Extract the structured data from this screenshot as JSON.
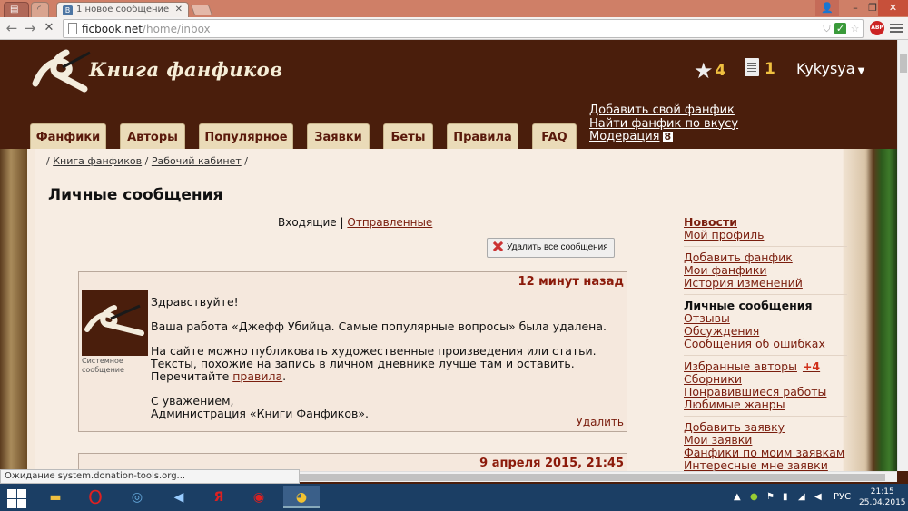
{
  "browser": {
    "tabs": [
      {
        "label": ""
      },
      {
        "label": ""
      },
      {
        "label": "1 новое сообщение",
        "favicon": "В"
      }
    ],
    "url_host": "ficbook.net",
    "url_path": "/home/inbox",
    "status_text": "Ожидание system.donation-tools.org...",
    "abp_label": "ABP"
  },
  "header": {
    "logo_text": "Книга фанфиков",
    "favorites_count": "4",
    "notes_count": "1",
    "username": "Kykysya",
    "quick_links": {
      "add": "Добавить свой фанфик",
      "find": "Найти фанфик по вкусу",
      "moderation": "Модерация",
      "moderation_count": "8"
    },
    "nav_tabs": [
      "Фанфики",
      "Авторы",
      "Популярное",
      "Заявки",
      "Беты",
      "Правила",
      "FAQ"
    ]
  },
  "breadcrumb": {
    "sep": "/",
    "items": [
      "Книга фанфиков",
      "Рабочий кабинет"
    ]
  },
  "page_title": "Личные сообщения",
  "msg_tabs": {
    "inbox": "Входящие",
    "sep": "|",
    "sent": "Отправленные"
  },
  "delete_all_label": "Удалить все сообщения",
  "messages": [
    {
      "time": "12 минут назад",
      "sender": "Системное сообщение",
      "greeting": "Здравствуйте!",
      "line1": "Ваша работа «Джефф Убийца. Самые популярные вопросы» была удалена.",
      "line2_pre": "На сайте можно публиковать художественные произведения или статьи. Тексты, похожие на запись в личном дневнике лучше там и оставить. Перечитайте ",
      "line2_link": "правила",
      "line2_post": ".",
      "sign1": "С уважением,",
      "sign2": "Администрация «Книги Фанфиков».",
      "delete_label": "Удалить"
    },
    {
      "time": "9 апреля 2015, 21:45"
    }
  ],
  "sidebar": {
    "news": "Новости",
    "profile": "Мой профиль",
    "add_fic": "Добавить фанфик",
    "my_fics": "Мои фанфики",
    "history": "История изменений",
    "messages": "Личные сообщения",
    "reviews": "Отзывы",
    "discussions": "Обсуждения",
    "error_reports": "Сообщения об ошибках",
    "fav_authors": "Избранные авторы",
    "fav_authors_new": "+4",
    "collections": "Сборники",
    "liked": "Понравившиеся работы",
    "genres": "Любимые жанры",
    "add_request": "Добавить заявку",
    "my_requests": "Мои заявки",
    "fics_by_requests": "Фанфики по моим заявкам",
    "interesting_requests": "Интересные мне заявки"
  },
  "taskbar": {
    "lang": "РУС",
    "time": "21:15",
    "date": "25.04.2015"
  }
}
